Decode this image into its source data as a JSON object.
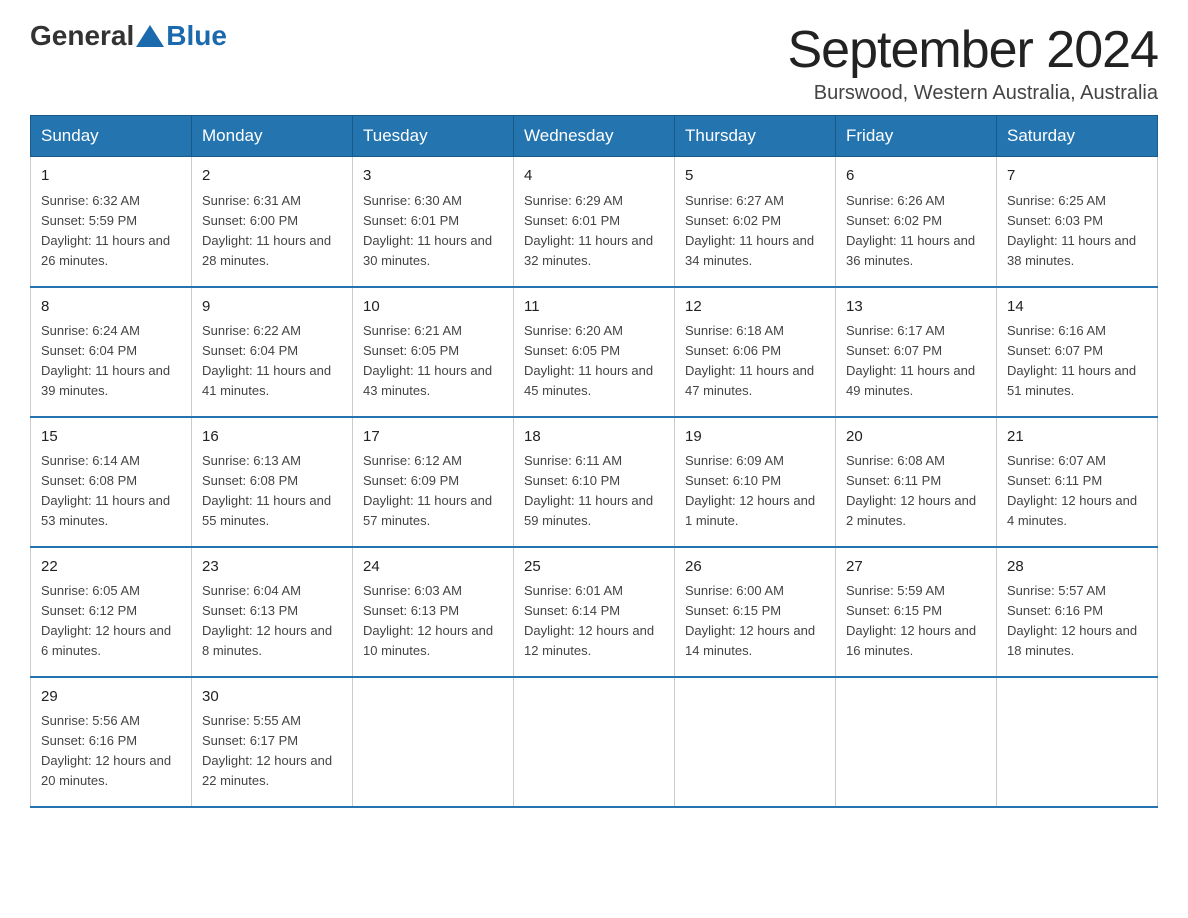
{
  "header": {
    "logo_general": "General",
    "logo_blue": "Blue",
    "month_title": "September 2024",
    "location": "Burswood, Western Australia, Australia"
  },
  "weekdays": [
    "Sunday",
    "Monday",
    "Tuesday",
    "Wednesday",
    "Thursday",
    "Friday",
    "Saturday"
  ],
  "weeks": [
    [
      {
        "day": "1",
        "sunrise": "6:32 AM",
        "sunset": "5:59 PM",
        "daylight": "11 hours and 26 minutes."
      },
      {
        "day": "2",
        "sunrise": "6:31 AM",
        "sunset": "6:00 PM",
        "daylight": "11 hours and 28 minutes."
      },
      {
        "day": "3",
        "sunrise": "6:30 AM",
        "sunset": "6:01 PM",
        "daylight": "11 hours and 30 minutes."
      },
      {
        "day": "4",
        "sunrise": "6:29 AM",
        "sunset": "6:01 PM",
        "daylight": "11 hours and 32 minutes."
      },
      {
        "day": "5",
        "sunrise": "6:27 AM",
        "sunset": "6:02 PM",
        "daylight": "11 hours and 34 minutes."
      },
      {
        "day": "6",
        "sunrise": "6:26 AM",
        "sunset": "6:02 PM",
        "daylight": "11 hours and 36 minutes."
      },
      {
        "day": "7",
        "sunrise": "6:25 AM",
        "sunset": "6:03 PM",
        "daylight": "11 hours and 38 minutes."
      }
    ],
    [
      {
        "day": "8",
        "sunrise": "6:24 AM",
        "sunset": "6:04 PM",
        "daylight": "11 hours and 39 minutes."
      },
      {
        "day": "9",
        "sunrise": "6:22 AM",
        "sunset": "6:04 PM",
        "daylight": "11 hours and 41 minutes."
      },
      {
        "day": "10",
        "sunrise": "6:21 AM",
        "sunset": "6:05 PM",
        "daylight": "11 hours and 43 minutes."
      },
      {
        "day": "11",
        "sunrise": "6:20 AM",
        "sunset": "6:05 PM",
        "daylight": "11 hours and 45 minutes."
      },
      {
        "day": "12",
        "sunrise": "6:18 AM",
        "sunset": "6:06 PM",
        "daylight": "11 hours and 47 minutes."
      },
      {
        "day": "13",
        "sunrise": "6:17 AM",
        "sunset": "6:07 PM",
        "daylight": "11 hours and 49 minutes."
      },
      {
        "day": "14",
        "sunrise": "6:16 AM",
        "sunset": "6:07 PM",
        "daylight": "11 hours and 51 minutes."
      }
    ],
    [
      {
        "day": "15",
        "sunrise": "6:14 AM",
        "sunset": "6:08 PM",
        "daylight": "11 hours and 53 minutes."
      },
      {
        "day": "16",
        "sunrise": "6:13 AM",
        "sunset": "6:08 PM",
        "daylight": "11 hours and 55 minutes."
      },
      {
        "day": "17",
        "sunrise": "6:12 AM",
        "sunset": "6:09 PM",
        "daylight": "11 hours and 57 minutes."
      },
      {
        "day": "18",
        "sunrise": "6:11 AM",
        "sunset": "6:10 PM",
        "daylight": "11 hours and 59 minutes."
      },
      {
        "day": "19",
        "sunrise": "6:09 AM",
        "sunset": "6:10 PM",
        "daylight": "12 hours and 1 minute."
      },
      {
        "day": "20",
        "sunrise": "6:08 AM",
        "sunset": "6:11 PM",
        "daylight": "12 hours and 2 minutes."
      },
      {
        "day": "21",
        "sunrise": "6:07 AM",
        "sunset": "6:11 PM",
        "daylight": "12 hours and 4 minutes."
      }
    ],
    [
      {
        "day": "22",
        "sunrise": "6:05 AM",
        "sunset": "6:12 PM",
        "daylight": "12 hours and 6 minutes."
      },
      {
        "day": "23",
        "sunrise": "6:04 AM",
        "sunset": "6:13 PM",
        "daylight": "12 hours and 8 minutes."
      },
      {
        "day": "24",
        "sunrise": "6:03 AM",
        "sunset": "6:13 PM",
        "daylight": "12 hours and 10 minutes."
      },
      {
        "day": "25",
        "sunrise": "6:01 AM",
        "sunset": "6:14 PM",
        "daylight": "12 hours and 12 minutes."
      },
      {
        "day": "26",
        "sunrise": "6:00 AM",
        "sunset": "6:15 PM",
        "daylight": "12 hours and 14 minutes."
      },
      {
        "day": "27",
        "sunrise": "5:59 AM",
        "sunset": "6:15 PM",
        "daylight": "12 hours and 16 minutes."
      },
      {
        "day": "28",
        "sunrise": "5:57 AM",
        "sunset": "6:16 PM",
        "daylight": "12 hours and 18 minutes."
      }
    ],
    [
      {
        "day": "29",
        "sunrise": "5:56 AM",
        "sunset": "6:16 PM",
        "daylight": "12 hours and 20 minutes."
      },
      {
        "day": "30",
        "sunrise": "5:55 AM",
        "sunset": "6:17 PM",
        "daylight": "12 hours and 22 minutes."
      },
      null,
      null,
      null,
      null,
      null
    ]
  ],
  "labels": {
    "sunrise_prefix": "Sunrise: ",
    "sunset_prefix": "Sunset: ",
    "daylight_prefix": "Daylight: "
  }
}
